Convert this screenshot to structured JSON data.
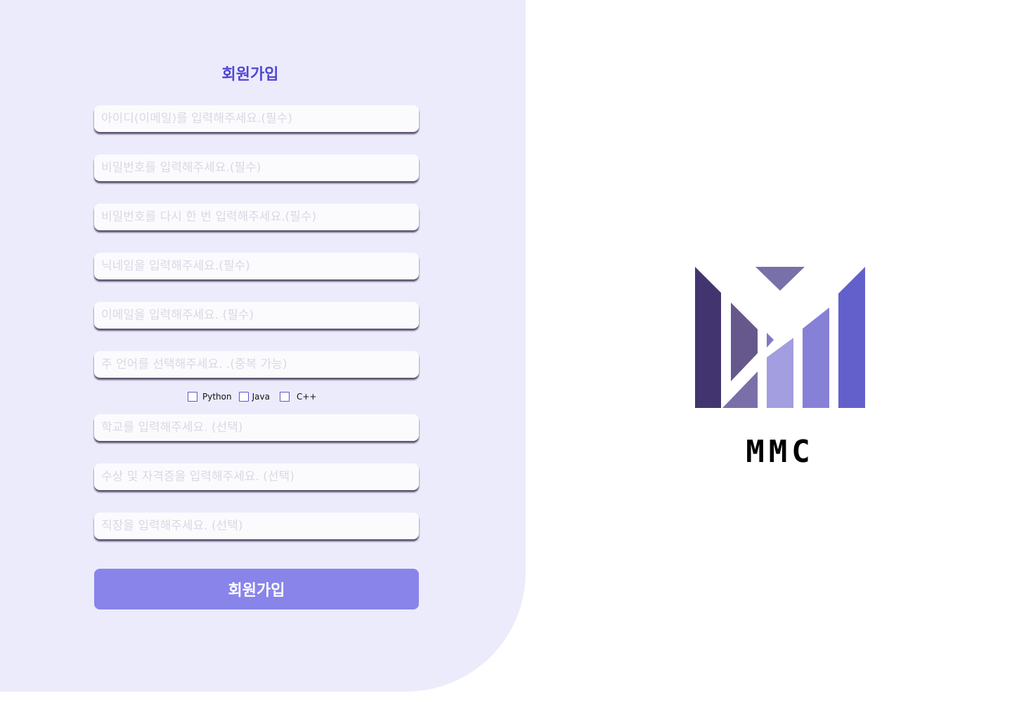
{
  "form": {
    "title": "회원가입",
    "fields": [
      {
        "placeholder": "아이디(이메일)를 입력해주세요.(필수)",
        "value": ""
      },
      {
        "placeholder": "비밀번호를 입력해주세요.(필수)",
        "value": ""
      },
      {
        "placeholder": "비밀번호를 다시 한 번 입력해주세요.(필수)",
        "value": ""
      },
      {
        "placeholder": "닉네임을 입력해주세요.(필수)",
        "value": ""
      },
      {
        "placeholder": "이메일을 입력해주세요. (필수)",
        "value": ""
      },
      {
        "placeholder": "주 언어를 선택해주세요. .(중복 가능)",
        "value": ""
      },
      {
        "placeholder": "학교를 입력해주세요. (선택)",
        "value": ""
      },
      {
        "placeholder": "수상 및 자격증을 입력해주세요. (선택)",
        "value": ""
      },
      {
        "placeholder": "직장을 입력해주세요. (선택)",
        "value": ""
      }
    ],
    "languages": [
      {
        "label": "Python",
        "checked": false
      },
      {
        "label": "Java",
        "checked": false
      },
      {
        "label": "C++",
        "checked": false
      }
    ],
    "submit_label": "회원가입"
  },
  "brand": {
    "name": "MMC",
    "logo_icon": "mmc-logo-icon"
  },
  "colors": {
    "panel_bg": "#ecebfb",
    "accent": "#5046d4",
    "button_bg": "#8984ea",
    "checkbox_border": "#5a53d8"
  }
}
